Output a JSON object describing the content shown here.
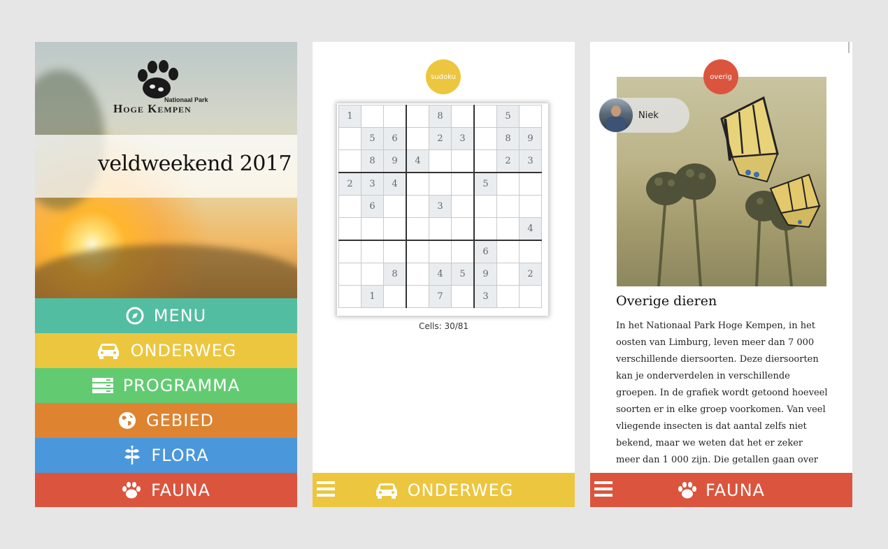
{
  "colors": {
    "menu": "#53bda1",
    "onderweg": "#ecc63e",
    "programma": "#62cb72",
    "gebied": "#de8330",
    "flora": "#4a97db",
    "fauna": "#db553e",
    "background": "#e6e6e6"
  },
  "home": {
    "logo": {
      "sub": "Nationaal Park",
      "title": "Hoge Kempen"
    },
    "event_title": "veldweekend 2017",
    "menu": [
      {
        "label": "MENU",
        "icon": "compass-icon"
      },
      {
        "label": "ONDERWEG",
        "icon": "car-icon"
      },
      {
        "label": "PROGRAMMA",
        "icon": "list-icon"
      },
      {
        "label": "GEBIED",
        "icon": "globe-icon"
      },
      {
        "label": "FLORA",
        "icon": "leaf-icon"
      },
      {
        "label": "FAUNA",
        "icon": "paw-icon"
      }
    ]
  },
  "sudoku_screen": {
    "badge": "sudoku",
    "grid": [
      [
        "1",
        "",
        "",
        "",
        "8",
        "",
        "",
        "5",
        ""
      ],
      [
        "",
        "5",
        "6",
        "",
        "2",
        "3",
        "",
        "8",
        "9"
      ],
      [
        "",
        "8",
        "9",
        "4",
        "",
        "",
        "",
        "2",
        "3"
      ],
      [
        "2",
        "3",
        "4",
        "",
        "",
        "",
        "5",
        "",
        ""
      ],
      [
        "",
        "6",
        "",
        "",
        "3",
        "",
        "",
        "",
        ""
      ],
      [
        "",
        "",
        "",
        "",
        "",
        "",
        "",
        "",
        "4"
      ],
      [
        "",
        "",
        "",
        "",
        "",
        "",
        "6",
        "",
        ""
      ],
      [
        "",
        "",
        "8",
        "",
        "4",
        "5",
        "9",
        "",
        "2"
      ],
      [
        "",
        "1",
        "",
        "",
        "7",
        "",
        "3",
        "",
        ""
      ]
    ],
    "cells_count": "Cells: 30/81",
    "bottom_bar": {
      "label": "ONDERWEG",
      "icon": "car-icon"
    }
  },
  "fauna_screen": {
    "badge": "overig",
    "user": {
      "name": "Niek"
    },
    "section_title": "Overige dieren",
    "body": "In het Nationaal Park Hoge Kempen, in het oosten van Limburg, leven meer dan 7 000 verschillende diersoorten. Deze diersoorten kan je onderverdelen in verschillende groepen. In de grafiek wordt getoond hoeveel soorten er in elke groep voorkomen. Van veel vliegende insecten is dat aantal zelfs niet bekend, maar we weten dat het er zeker meer dan 1 000 zijn. Die getallen gaan over",
    "bottom_bar": {
      "label": "FAUNA",
      "icon": "paw-icon"
    }
  }
}
